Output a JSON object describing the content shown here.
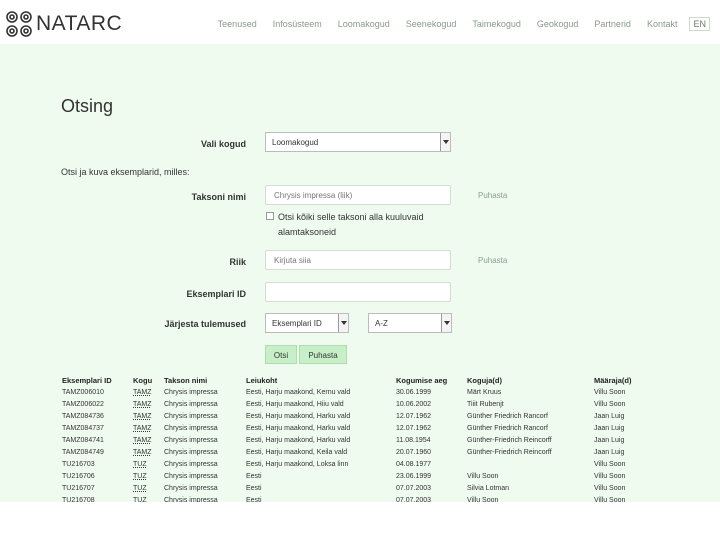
{
  "brand": {
    "name": "NATARC"
  },
  "nav": [
    {
      "label": "Teenused"
    },
    {
      "label": "Infosüsteem"
    },
    {
      "label": "Loomakogud"
    },
    {
      "label": "Seenekogud"
    },
    {
      "label": "Taimekogud"
    },
    {
      "label": "Geokogud"
    },
    {
      "label": "Partnerid"
    },
    {
      "label": "Kontakt"
    }
  ],
  "lang": "EN",
  "page": {
    "title": "Otsing"
  },
  "form": {
    "collection_label": "Vali kogud",
    "collection_value": "Loomakogud",
    "intro": "Otsi ja kuva eksemplarid, milles:",
    "taxon_label": "Taksoni nimi",
    "taxon_value": "Chrysis impressa (liik)",
    "taxon_clear": "Puhasta",
    "include_sub_label": "Otsi kõiki selle taksoni alla kuuluvaid",
    "include_sub_label_2": "alamtaksoneid",
    "country_label": "Riik",
    "country_placeholder": "Kirjuta siia",
    "country_clear": "Puhasta",
    "specimen_label": "Eksemplari ID",
    "sort_label": "Järjesta tulemused",
    "sort_field": "Eksemplari ID",
    "sort_order": "A-Z",
    "search_button": "Otsi",
    "clear_button": "Puhasta"
  },
  "results": {
    "columns": [
      "Eksemplari ID",
      "Kogu",
      "Takson nimi",
      "Leiukoht",
      "Kogumise aeg",
      "Koguja(d)",
      "Määraja(d)"
    ],
    "rows": [
      [
        "TAMZ006010",
        "TAMZ",
        "Chrysis impressa",
        "Eesti, Harju maakond, Kernu vald",
        "30.06.1999",
        "Märt Kruus",
        "Villu Soon"
      ],
      [
        "TAMZ006022",
        "TAMZ",
        "Chrysis impressa",
        "Eesti, Harju maakond, Hiiu vald",
        "10.06.2002",
        "Tiiit Rubenjt",
        "Villu Soon"
      ],
      [
        "TAMZ084736",
        "TAMZ",
        "Chrysis impressa",
        "Eesti, Harju maakond, Harku vald",
        "12.07.1962",
        "Günther Friedrich Rancorf",
        "Jaan Luig"
      ],
      [
        "TAMZ084737",
        "TAMZ",
        "Chrysis impressa",
        "Eesti, Harju maakond, Harku vald",
        "12.07.1962",
        "Günther Friedrich Rancorf",
        "Jaan Luig"
      ],
      [
        "TAMZ084741",
        "TAMZ",
        "Chrysis impressa",
        "Eesti, Harju maakond, Harku vald",
        "11.08.1954",
        "Günther-Friedrich Reincorff",
        "Jaan Luig"
      ],
      [
        "TAMZ084749",
        "TAMZ",
        "Chrysis impressa",
        "Eesti, Harju maakond, Keila vald",
        "20.07.1960",
        "Günther-Friedrich Reincorff",
        "Jaan Luig"
      ],
      [
        "TU216703",
        "TUZ",
        "Chrysis impressa",
        "Eesti, Harju maakond, Loksa linn",
        "04.08.1977",
        "",
        "Villu Soon"
      ],
      [
        "TU216706",
        "TUZ",
        "Chrysis impressa",
        "Eesti",
        "23.06.1999",
        "Villu Soon",
        "Villu Soon"
      ],
      [
        "TU216707",
        "TUZ",
        "Chrysis impressa",
        "Eesti",
        "07.07.2003",
        "Silvia Lotman",
        "Villu Soon"
      ],
      [
        "TU216708",
        "TUZ",
        "Chrysis impressa",
        "Eesti",
        "07.07.2003",
        "Villu Soon",
        "Villu Soon"
      ]
    ]
  }
}
